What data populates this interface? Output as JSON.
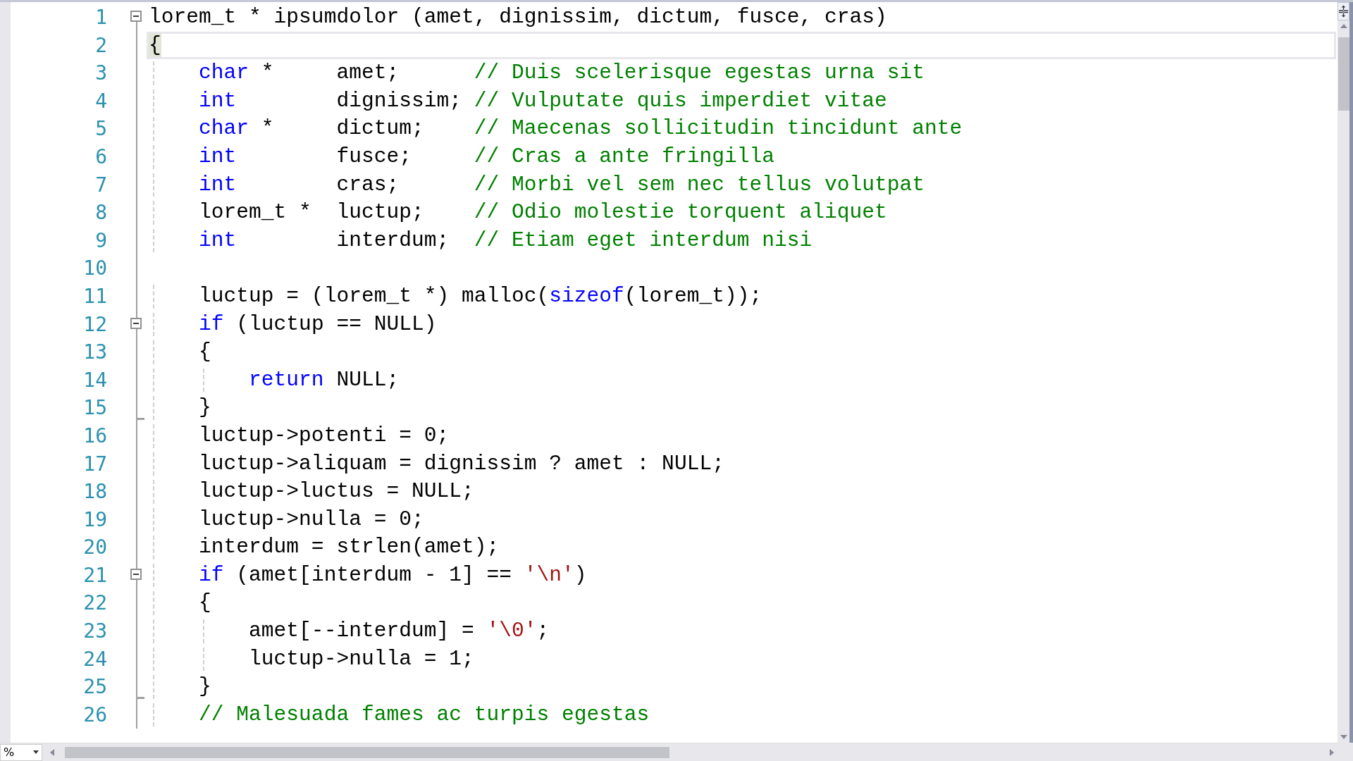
{
  "editor": {
    "lines": [
      {
        "number": "1",
        "expanded": true,
        "block_end": false,
        "current": false,
        "tokens": [
          {
            "kind": "plain",
            "text": "lorem_t * ipsumdolor (amet, dignissim, dictum, fusce, cras)"
          }
        ]
      },
      {
        "number": "2",
        "block_end": false,
        "current": true,
        "tokens": [
          {
            "kind": "brace-match",
            "text": "{"
          }
        ]
      },
      {
        "number": "3",
        "block_end": false,
        "current": false,
        "tokens": [
          {
            "kind": "keyword",
            "text": "    char"
          },
          {
            "kind": "plain",
            "text": " *     amet;      "
          },
          {
            "kind": "comment",
            "text": "// Duis scelerisque egestas urna sit"
          }
        ]
      },
      {
        "number": "4",
        "block_end": false,
        "current": false,
        "tokens": [
          {
            "kind": "keyword",
            "text": "    int"
          },
          {
            "kind": "plain",
            "text": "        dignissim; "
          },
          {
            "kind": "comment",
            "text": "// Vulputate quis imperdiet vitae"
          }
        ]
      },
      {
        "number": "5",
        "block_end": false,
        "current": false,
        "tokens": [
          {
            "kind": "keyword",
            "text": "    char"
          },
          {
            "kind": "plain",
            "text": " *     dictum;    "
          },
          {
            "kind": "comment",
            "text": "// Maecenas sollicitudin tincidunt ante"
          }
        ]
      },
      {
        "number": "6",
        "block_end": false,
        "current": false,
        "tokens": [
          {
            "kind": "keyword",
            "text": "    int"
          },
          {
            "kind": "plain",
            "text": "        fusce;     "
          },
          {
            "kind": "comment",
            "text": "// Cras a ante fringilla"
          }
        ]
      },
      {
        "number": "7",
        "block_end": false,
        "current": false,
        "tokens": [
          {
            "kind": "keyword",
            "text": "    int"
          },
          {
            "kind": "plain",
            "text": "        cras;      "
          },
          {
            "kind": "comment",
            "text": "// Morbi vel sem nec tellus volutpat"
          }
        ]
      },
      {
        "number": "8",
        "block_end": false,
        "current": false,
        "tokens": [
          {
            "kind": "plain",
            "text": "    lorem_t *  luctup;    "
          },
          {
            "kind": "comment",
            "text": "// Odio molestie torquent aliquet"
          }
        ]
      },
      {
        "number": "9",
        "block_end": false,
        "current": false,
        "tokens": [
          {
            "kind": "keyword",
            "text": "    int"
          },
          {
            "kind": "plain",
            "text": "        interdum;  "
          },
          {
            "kind": "comment",
            "text": "// Etiam eget interdum nisi"
          }
        ]
      },
      {
        "number": "10",
        "block_end": false,
        "current": false
      },
      {
        "number": "11",
        "block_end": false,
        "current": false,
        "tokens": [
          {
            "kind": "plain",
            "text": "    luctup = (lorem_t *) malloc("
          },
          {
            "kind": "keyword",
            "text": "sizeof"
          },
          {
            "kind": "plain",
            "text": "(lorem_t));"
          }
        ]
      },
      {
        "number": "12",
        "expanded": true,
        "block_end": false,
        "current": false,
        "tokens": [
          {
            "kind": "keyword",
            "text": "    if"
          },
          {
            "kind": "plain",
            "text": " (luctup == NULL)"
          }
        ]
      },
      {
        "number": "13",
        "block_end": false,
        "current": false,
        "tokens": [
          {
            "kind": "plain",
            "text": "    {"
          }
        ]
      },
      {
        "number": "14",
        "block_end": false,
        "current": false,
        "tokens": [
          {
            "kind": "keyword",
            "text": "        return"
          },
          {
            "kind": "plain",
            "text": " NULL;"
          }
        ]
      },
      {
        "number": "15",
        "block_end": true,
        "current": false,
        "tokens": [
          {
            "kind": "plain",
            "text": "    }"
          }
        ]
      },
      {
        "number": "16",
        "block_end": false,
        "current": false,
        "tokens": [
          {
            "kind": "plain",
            "text": "    luctup->potenti = 0;"
          }
        ]
      },
      {
        "number": "17",
        "block_end": false,
        "current": false,
        "tokens": [
          {
            "kind": "plain",
            "text": "    luctup->aliquam = dignissim ? amet : NULL;"
          }
        ]
      },
      {
        "number": "18",
        "block_end": false,
        "current": false,
        "tokens": [
          {
            "kind": "plain",
            "text": "    luctup->luctus = NULL;"
          }
        ]
      },
      {
        "number": "19",
        "block_end": false,
        "current": false,
        "tokens": [
          {
            "kind": "plain",
            "text": "    luctup->nulla = 0;"
          }
        ]
      },
      {
        "number": "20",
        "block_end": false,
        "current": false,
        "tokens": [
          {
            "kind": "plain",
            "text": "    interdum = strlen(amet);"
          }
        ]
      },
      {
        "number": "21",
        "expanded": true,
        "block_end": false,
        "current": false,
        "tokens": [
          {
            "kind": "keyword",
            "text": "    if"
          },
          {
            "kind": "plain",
            "text": " (amet[interdum - 1] == "
          },
          {
            "kind": "string",
            "text": "'\\n'"
          },
          {
            "kind": "plain",
            "text": ")"
          }
        ]
      },
      {
        "number": "22",
        "block_end": false,
        "current": false,
        "tokens": [
          {
            "kind": "plain",
            "text": "    {"
          }
        ]
      },
      {
        "number": "23",
        "block_end": false,
        "current": false,
        "tokens": [
          {
            "kind": "plain",
            "text": "        amet[--interdum] = "
          },
          {
            "kind": "string",
            "text": "'\\0'"
          },
          {
            "kind": "plain",
            "text": ";"
          }
        ]
      },
      {
        "number": "24",
        "block_end": false,
        "current": false,
        "tokens": [
          {
            "kind": "plain",
            "text": "        luctup->nulla = 1;"
          }
        ]
      },
      {
        "number": "25",
        "block_end": true,
        "current": false,
        "tokens": [
          {
            "kind": "plain",
            "text": "    }"
          }
        ]
      },
      {
        "number": "26",
        "block_end": false,
        "current": false,
        "tokens": [
          {
            "kind": "comment",
            "text": "    // Malesuada fames ac turpis egestas"
          }
        ]
      }
    ]
  },
  "zoom_control": {
    "value": "%"
  }
}
